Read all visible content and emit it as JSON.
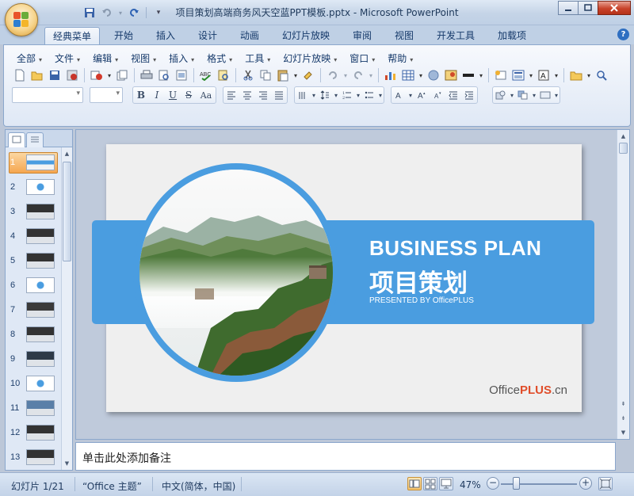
{
  "window": {
    "title": "项目策划高端商务风天空蓝PPT模板.pptx - Microsoft PowerPoint"
  },
  "tabs": [
    "经典菜单",
    "开始",
    "插入",
    "设计",
    "动画",
    "幻灯片放映",
    "审阅",
    "视图",
    "开发工具",
    "加载项"
  ],
  "active_tab": "经典菜单",
  "menu": [
    "全部",
    "文件",
    "编辑",
    "视图",
    "插入",
    "格式",
    "工具",
    "幻灯片放映",
    "窗口",
    "帮助"
  ],
  "format_buttons": [
    "B",
    "I",
    "U",
    "S",
    "Aa"
  ],
  "slides": {
    "count": 13,
    "selected": 1,
    "numbers": [
      "1",
      "2",
      "3",
      "4",
      "5",
      "6",
      "7",
      "8",
      "9",
      "10",
      "11",
      "12",
      "13"
    ]
  },
  "slide": {
    "title": "BUSINESS PLAN",
    "subtitle": "项目策划",
    "presented": "PRESENTED BY OfficePLUS",
    "logo_a": "Office",
    "logo_b": "PLUS",
    "logo_c": ".cn",
    "accent": "#4a9de0"
  },
  "notes": {
    "placeholder": "单击此处添加备注"
  },
  "status": {
    "slide_info": "幻灯片 1/21",
    "theme": "“Office 主题”",
    "language": "中文(简体，中国)",
    "zoom": "47%",
    "zoom_value": 47
  }
}
